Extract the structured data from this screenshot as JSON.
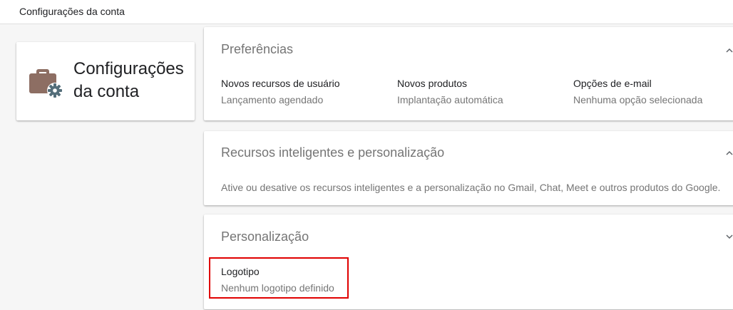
{
  "header": {
    "breadcrumb": "Configurações da conta"
  },
  "left_card": {
    "title": "Configurações da conta",
    "icon": "briefcase-gear-icon",
    "icon_color": "#8d6e63",
    "gear_color": "#546e7a"
  },
  "panels": [
    {
      "title": "Preferências",
      "expanded": true,
      "settings": [
        {
          "label": "Novos recursos de usuário",
          "value": "Lançamento agendado"
        },
        {
          "label": "Novos produtos",
          "value": "Implantação automática"
        },
        {
          "label": "Opções de e-mail",
          "value": "Nenhuma opção selecionada"
        }
      ]
    },
    {
      "title": "Recursos inteligentes e personalização",
      "expanded": true,
      "description": "Ative ou desative os recursos inteligentes e a personalização no Gmail, Chat, Meet e outros produtos do Google."
    },
    {
      "title": "Personalização",
      "expanded": false,
      "settings": [
        {
          "label": "Logotipo",
          "value": "Nenhum logotipo definido"
        }
      ]
    }
  ],
  "highlight_color": "#e00000"
}
